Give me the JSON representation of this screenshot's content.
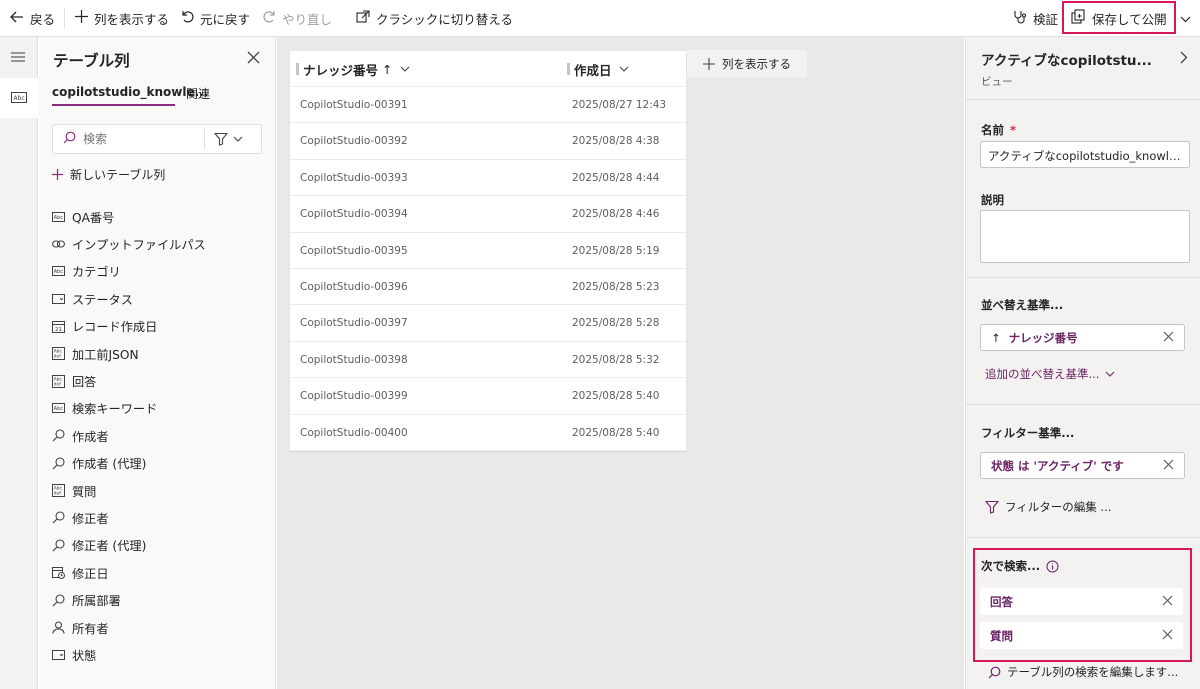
{
  "toolbar": {
    "back": "戻る",
    "show_columns": "列を表示する",
    "undo": "元に戻す",
    "redo": "やり直し",
    "switch_classic": "クラシックに切り替える",
    "validate": "検証",
    "save_publish": "保存して公開"
  },
  "columns_panel": {
    "title": "テーブル列",
    "tab_table": "copilotstudio_knowle...",
    "tab_related": "関連",
    "search_placeholder": "検索",
    "new_column": "新しいテーブル列",
    "fields": [
      {
        "label": "QA番号",
        "icon": "text-field-icon"
      },
      {
        "label": "インプットファイルパス",
        "icon": "link-icon"
      },
      {
        "label": "カテゴリ",
        "icon": "text-field-icon"
      },
      {
        "label": "ステータス",
        "icon": "choice-field-icon"
      },
      {
        "label": "レコード作成日",
        "icon": "calendar-icon"
      },
      {
        "label": "加工前JSON",
        "icon": "multiline-text-icon"
      },
      {
        "label": "回答",
        "icon": "multiline-text-icon"
      },
      {
        "label": "検索キーワード",
        "icon": "text-field-icon"
      },
      {
        "label": "作成者",
        "icon": "lookup-icon"
      },
      {
        "label": "作成者 (代理)",
        "icon": "lookup-icon"
      },
      {
        "label": "質問",
        "icon": "multiline-text-icon"
      },
      {
        "label": "修正者",
        "icon": "lookup-icon"
      },
      {
        "label": "修正者 (代理)",
        "icon": "lookup-icon"
      },
      {
        "label": "修正日",
        "icon": "datetime-icon"
      },
      {
        "label": "所属部署",
        "icon": "lookup-icon"
      },
      {
        "label": "所有者",
        "icon": "person-icon"
      },
      {
        "label": "状態",
        "icon": "choice-field-icon"
      }
    ]
  },
  "grid": {
    "col1": "ナレッジ番号",
    "col1_sort": "↑",
    "col2": "作成日",
    "add_column": "列を表示する",
    "rows": [
      {
        "id": "CopilotStudio-00391",
        "date": "2025/08/27 12:43"
      },
      {
        "id": "CopilotStudio-00392",
        "date": "2025/08/28 4:38"
      },
      {
        "id": "CopilotStudio-00393",
        "date": "2025/08/28 4:44"
      },
      {
        "id": "CopilotStudio-00394",
        "date": "2025/08/28 4:46"
      },
      {
        "id": "CopilotStudio-00395",
        "date": "2025/08/28 5:19"
      },
      {
        "id": "CopilotStudio-00396",
        "date": "2025/08/28 5:23"
      },
      {
        "id": "CopilotStudio-00397",
        "date": "2025/08/28 5:28"
      },
      {
        "id": "CopilotStudio-00398",
        "date": "2025/08/28 5:32"
      },
      {
        "id": "CopilotStudio-00399",
        "date": "2025/08/28 5:40"
      },
      {
        "id": "CopilotStudio-00400",
        "date": "2025/08/28 5:40"
      }
    ]
  },
  "view_panel": {
    "title": "アクティブなcopilotstu...",
    "subtitle": "ビュー",
    "name_label": "名前",
    "required_mark": "*",
    "name_value": "アクティブなcopilotstudio_knowle...",
    "desc_label": "説明",
    "sort_label": "並べ替え基準...",
    "sort_chip": "ナレッジ番号",
    "sort_arrow": "↑",
    "add_sort": "追加の並べ替え基準...",
    "filter_label": "フィルター基準...",
    "filter_chip": "状態 は 'アクティブ' です",
    "edit_filter": "フィルターの編集 ...",
    "search_label": "次で検索...",
    "search_chips": [
      "回答",
      "質問"
    ],
    "edit_search": "テーブル列の検索を編集します..."
  },
  "colors": {
    "accent": "#8a2d80",
    "highlight": "#d6175c",
    "chip_text": "#6b2466"
  }
}
